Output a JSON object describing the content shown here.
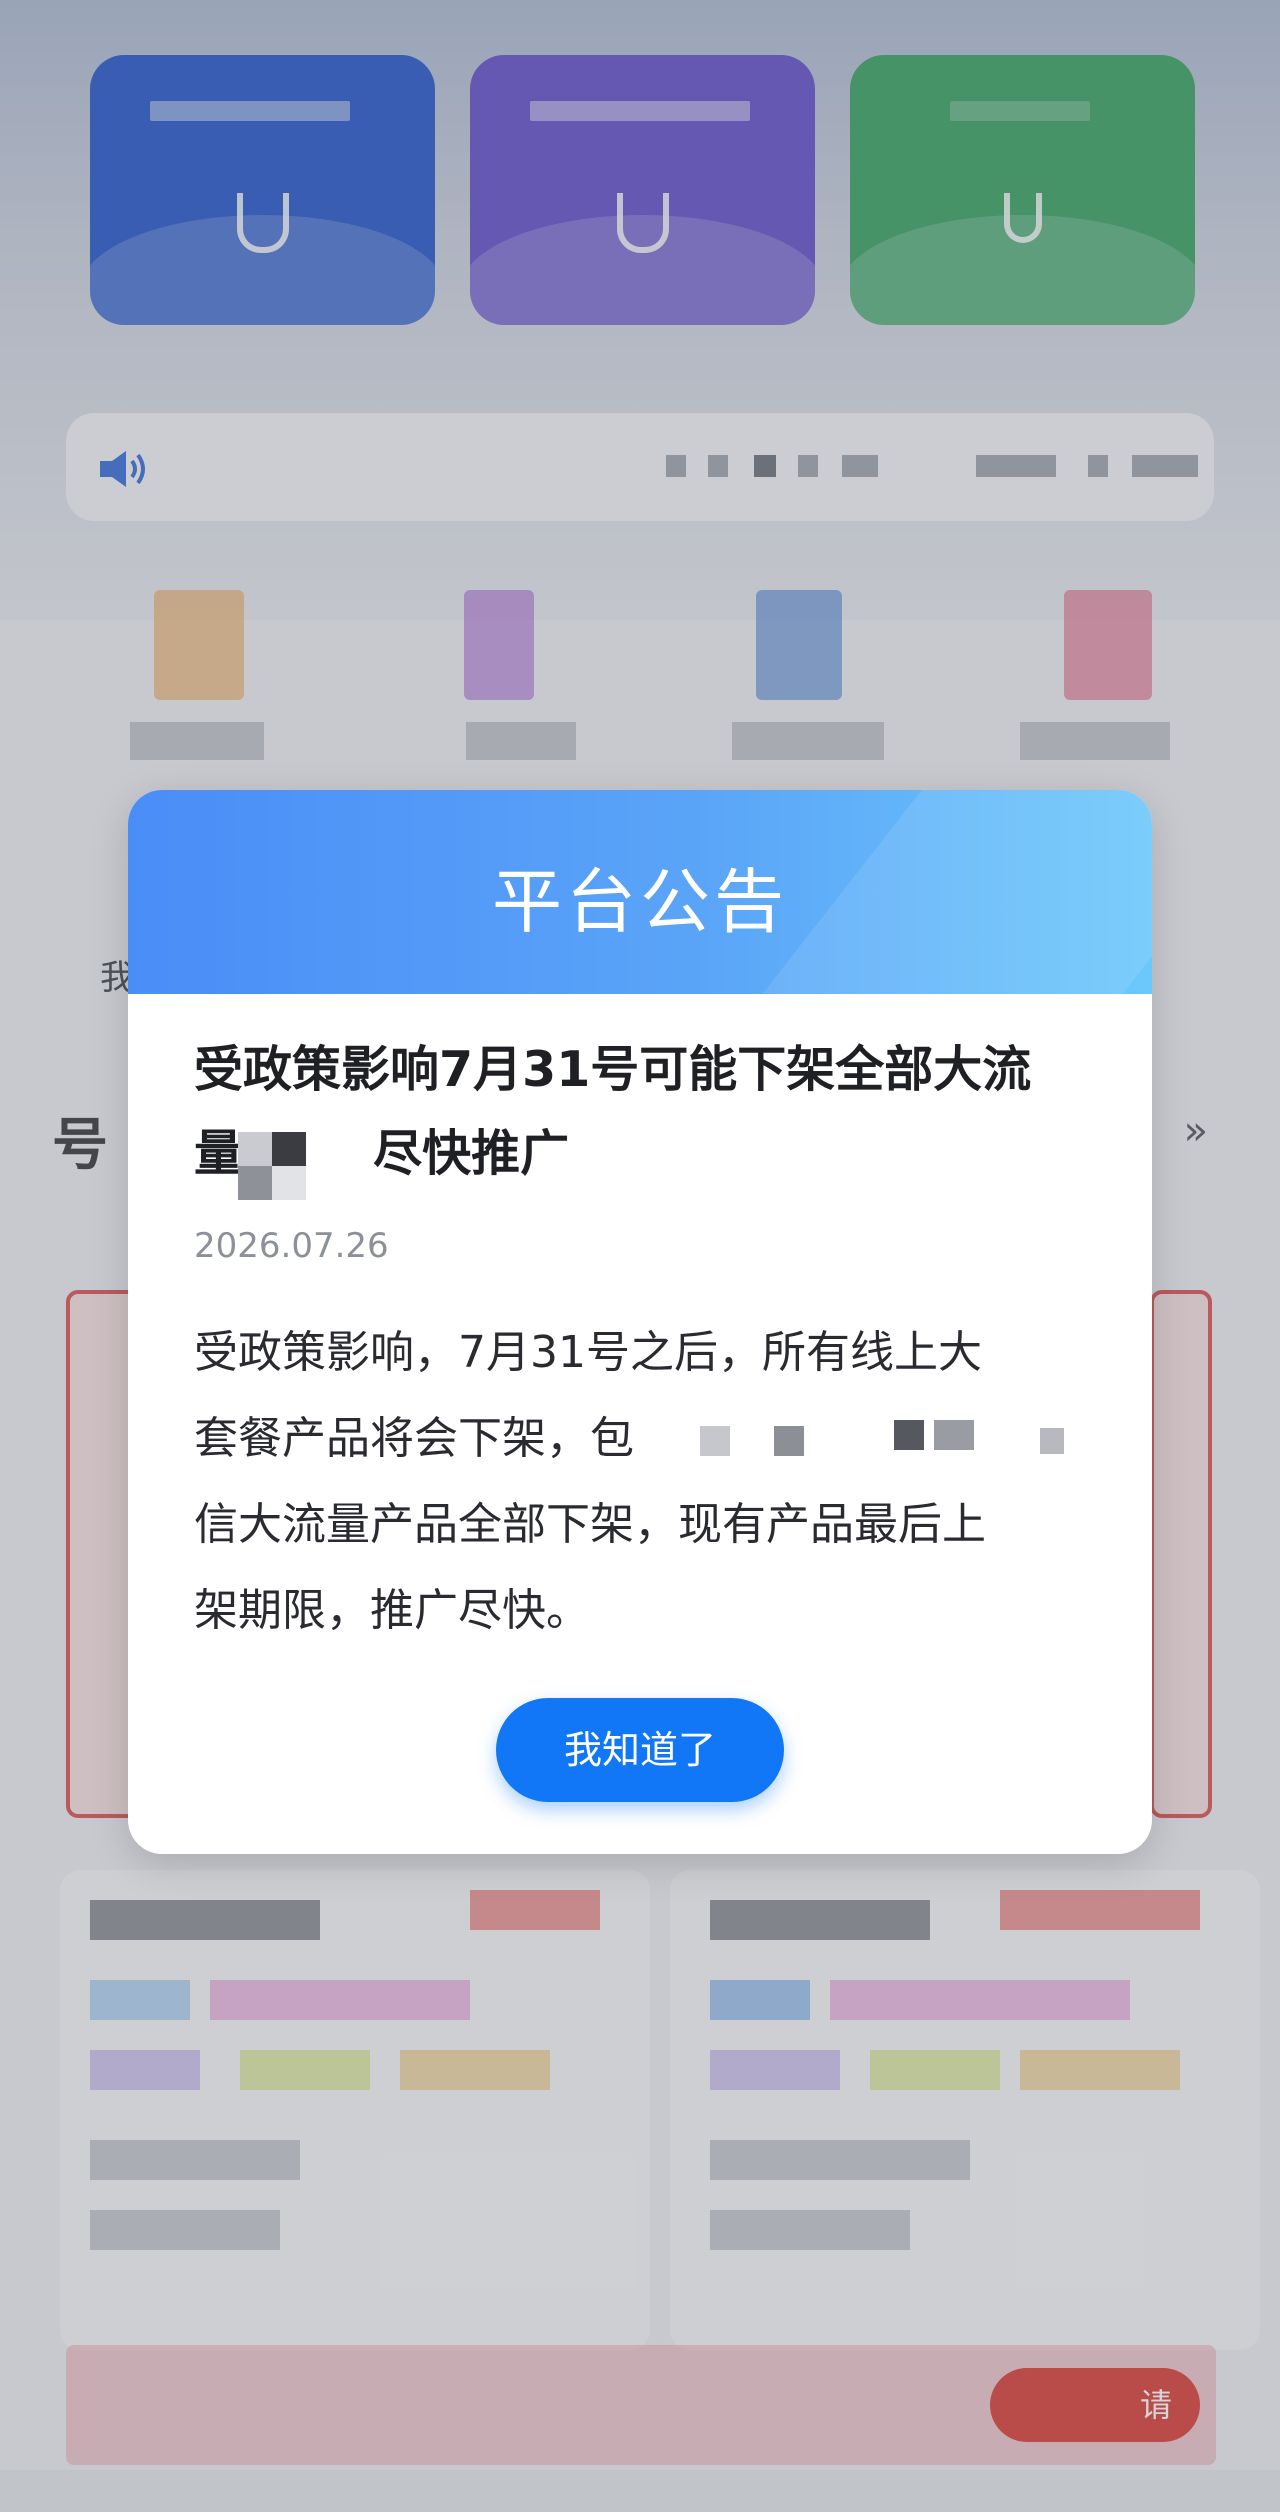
{
  "colors": {
    "tile_blue": "#1a4fc9",
    "tile_purple": "#5b48c9",
    "tile_green": "#2e9e5c",
    "modal_header_start": "#4a8df7",
    "modal_header_end": "#6cc8fb",
    "button": "#1277f6",
    "banner_button": "#d8342f"
  },
  "notice_bar": {
    "icon": "speaker-icon"
  },
  "background": {
    "section_title_glyph": "号",
    "more_icon": "»",
    "edge_glyph": "我",
    "banner_button_text": "请"
  },
  "modal": {
    "title": "平台公告",
    "headline_line1": "受政策影响7月31号可能下架全部大流",
    "headline_line2_start": "量",
    "headline_line2_end": "尽快推广",
    "date": "2026.07.26",
    "body_line1": "受政策影响，7月31号之后，所有线上大",
    "body_line2": "套餐产品将会下架，包",
    "body_line3": "信大流量产品全部下架，现有产品最后上",
    "body_line4": "架期限，推广尽快。",
    "button": "我知道了"
  }
}
